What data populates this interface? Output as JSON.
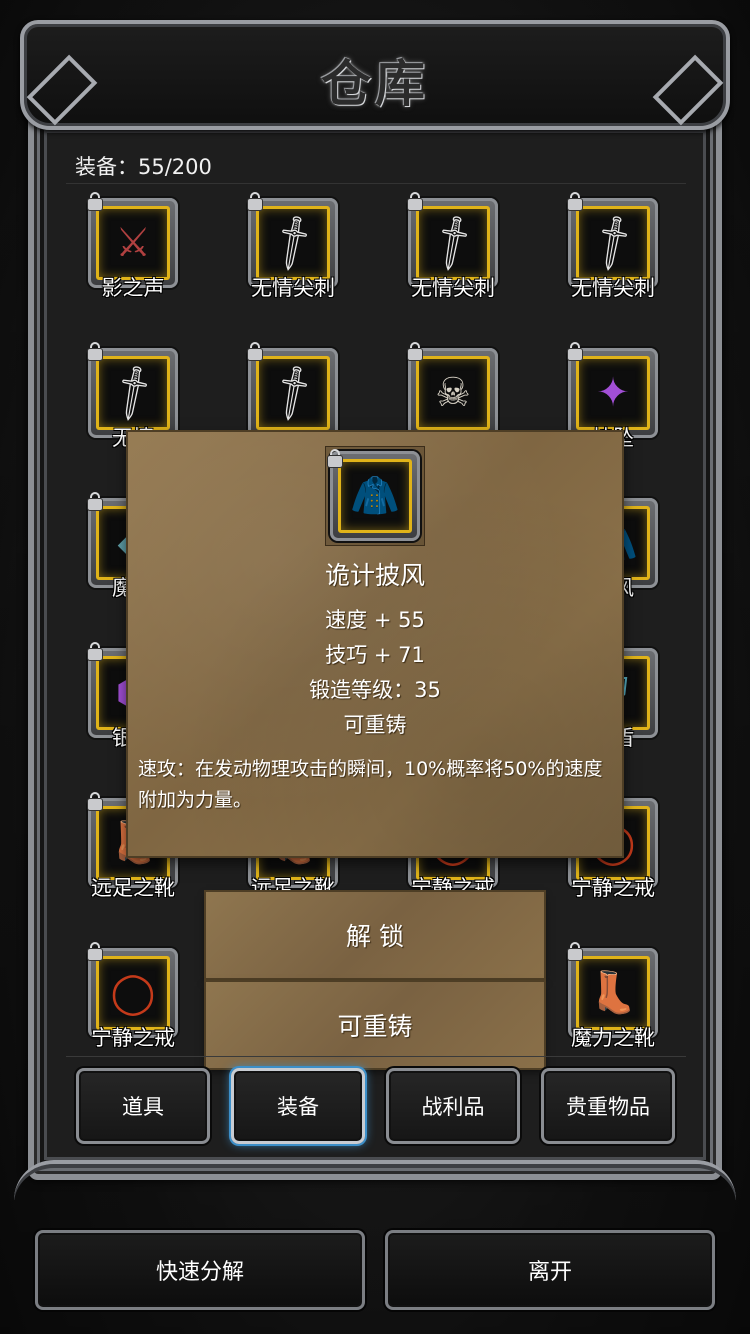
{
  "header": {
    "title": "仓库"
  },
  "capacity": {
    "label": "装备：55/200"
  },
  "grid": {
    "items": [
      {
        "label": "影之声",
        "icon": "dark-blade-icon"
      },
      {
        "label": "无情尖刺",
        "icon": "dagger-icon"
      },
      {
        "label": "无情尖刺",
        "icon": "dagger-icon"
      },
      {
        "label": "无情尖刺",
        "icon": "dagger-icon"
      },
      {
        "label": "无情",
        "icon": "dagger-icon"
      },
      {
        "label": "",
        "icon": "dagger-icon"
      },
      {
        "label": "",
        "icon": "skull-mask-icon"
      },
      {
        "label": "挂坠",
        "icon": "pendant-icon"
      },
      {
        "label": "魔剑",
        "icon": "teal-gem-icon"
      },
      {
        "label": "",
        "icon": "hidden-icon"
      },
      {
        "label": "",
        "icon": "hidden-icon"
      },
      {
        "label": "披风",
        "icon": "cloak-icon"
      },
      {
        "label": "银骑",
        "icon": "purple-armor-icon"
      },
      {
        "label": "",
        "icon": "hidden-icon"
      },
      {
        "label": "",
        "icon": "hidden-icon"
      },
      {
        "label": "之盾",
        "icon": "shield-icon"
      },
      {
        "label": "远足之靴",
        "icon": "boots-icon"
      },
      {
        "label": "远足之靴",
        "icon": "boots-icon"
      },
      {
        "label": "宁静之戒",
        "icon": "ring-icon"
      },
      {
        "label": "宁静之戒",
        "icon": "ring-icon"
      },
      {
        "label": "宁静之戒",
        "icon": "ring-icon"
      },
      {
        "label": "",
        "icon": "hidden-icon"
      },
      {
        "label": "",
        "icon": "hidden-icon"
      },
      {
        "label": "魔力之靴",
        "icon": "boots-icon"
      }
    ]
  },
  "popup": {
    "name": "诡计披风",
    "icon": "cloak-icon",
    "stats": [
      "速度 + 55",
      "技巧 + 71",
      "锻造等级：35",
      "可重铸"
    ],
    "description": "速攻：在发动物理攻击的瞬间，10%概率将50%的速度附加为力量。"
  },
  "actions": {
    "unlock": "解 锁",
    "reforge": "可重铸"
  },
  "tabs": [
    {
      "label": "道具",
      "active": false
    },
    {
      "label": "装备",
      "active": true
    },
    {
      "label": "战利品",
      "active": false
    },
    {
      "label": "贵重物品",
      "active": false
    }
  ],
  "footer": {
    "decompose": "快速分解",
    "leave": "离开"
  },
  "colors": {
    "slot_border": "#e0b319",
    "active_tab_glow": "#3c8fc9",
    "parchment": "#8a7049"
  }
}
